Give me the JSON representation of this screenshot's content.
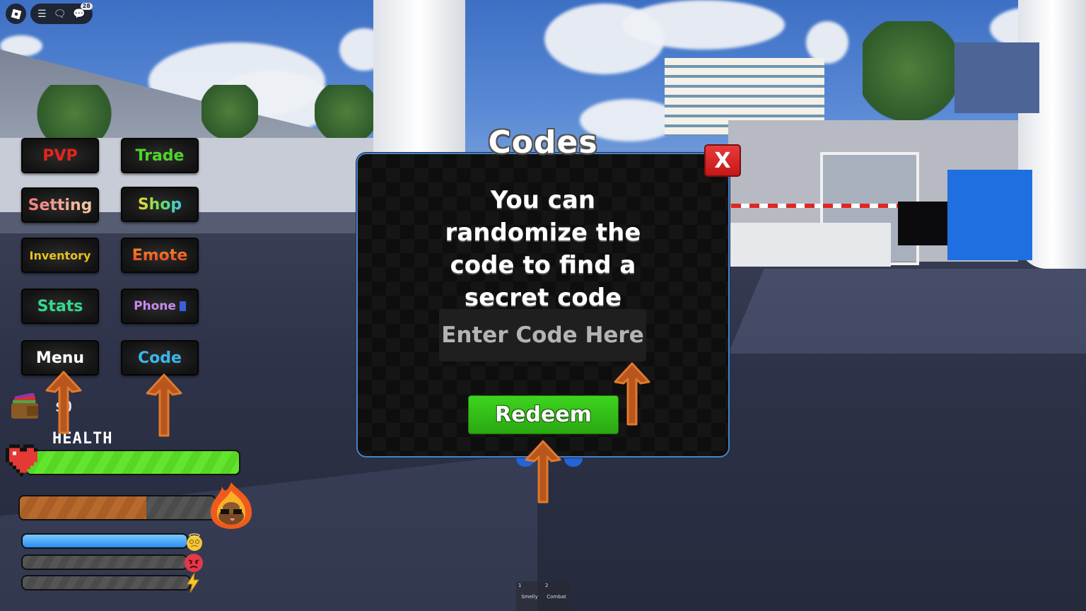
{
  "topbar": {
    "roblox_icon": "roblox-logo-icon",
    "menu_icon": "hamburger-menu-icon",
    "chat_icon": "chat-icon",
    "notifications_icon": "notifications-icon",
    "notifications_count": "28"
  },
  "side_menu": {
    "buttons": [
      {
        "label": "PVP",
        "color": "#e8231c"
      },
      {
        "label": "Trade",
        "color": "#4fd52a"
      },
      {
        "label": "Setting",
        "color": "#f08a8a"
      },
      {
        "label": "Shop",
        "color": "#b9e040"
      },
      {
        "label": "Inventory",
        "color": "#e6c21c"
      },
      {
        "label": "Emote",
        "color": "#f05a1c"
      },
      {
        "label": "Stats",
        "color": "#34d98c"
      },
      {
        "label": "Phone",
        "color": "#c78af0"
      },
      {
        "label": "Menu",
        "color": "#ffffff"
      },
      {
        "label": "Code",
        "color": "#38b8e8"
      }
    ]
  },
  "hud": {
    "wallet_icon": "wallet-icon",
    "money": "$0",
    "health_label": "HEALTH",
    "health_icon": "heart-icon",
    "health_fraction": 1.0,
    "smelly_fraction": 0.65,
    "smelly_icon": "flaming-poop-icon",
    "dizzy_fraction": 1.0,
    "dizzy_icon": "dizzy-face-icon",
    "anger_fraction": 0.0,
    "anger_icon": "angry-face-icon",
    "energy_fraction": 0.0,
    "energy_icon": "lightning-icon",
    "colors": {
      "health": "#5fe32a",
      "smelly": "#b86a2c",
      "dizzy": "#3aa6f2"
    }
  },
  "codes_modal": {
    "title": "Codes",
    "close_label": "X",
    "message": "You can randomize the code to find a secret code",
    "input_placeholder": "Enter Code Here",
    "input_value": "",
    "redeem_label": "Redeem"
  },
  "hotbar": {
    "slots": [
      {
        "number": "1",
        "label": "Smelly"
      },
      {
        "number": "2",
        "label": "Combat"
      }
    ]
  },
  "annotations": {
    "arrow_color": "#c4561c"
  }
}
